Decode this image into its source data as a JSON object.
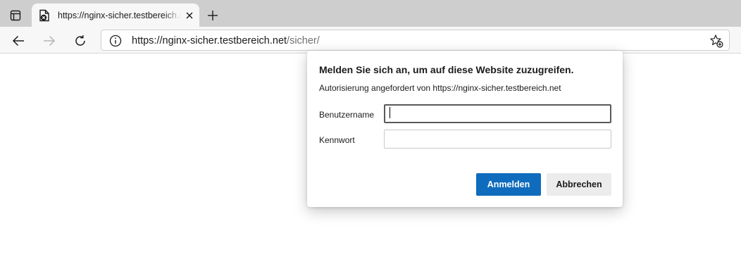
{
  "tab": {
    "title": "https://nginx-sicher.testbereich.net/sicher/"
  },
  "address_bar": {
    "url_host": "https://nginx-sicher.testbereich.net",
    "url_path": "/sicher/"
  },
  "icons": {
    "tab_actions": "tab-actions-icon",
    "favicon": "document-lock-icon",
    "close_tab": "close-icon",
    "new_tab": "plus-icon",
    "back": "arrow-left-icon",
    "forward": "arrow-right-icon",
    "reload": "reload-icon",
    "site_info": "info-icon",
    "add_favorite": "star-plus-icon"
  },
  "auth_dialog": {
    "title": "Melden Sie sich an, um auf diese Website zuzugreifen.",
    "subtitle": "Autorisierung angefordert von https://nginx-sicher.testbereich.net",
    "username_label": "Benutzername",
    "username_value": "",
    "password_label": "Kennwort",
    "password_value": "",
    "signin_label": "Anmelden",
    "cancel_label": "Abbrechen"
  },
  "colors": {
    "primary_button": "#0f6cbd",
    "tabbar": "#cecece",
    "toolbar": "#f7f7f7"
  }
}
